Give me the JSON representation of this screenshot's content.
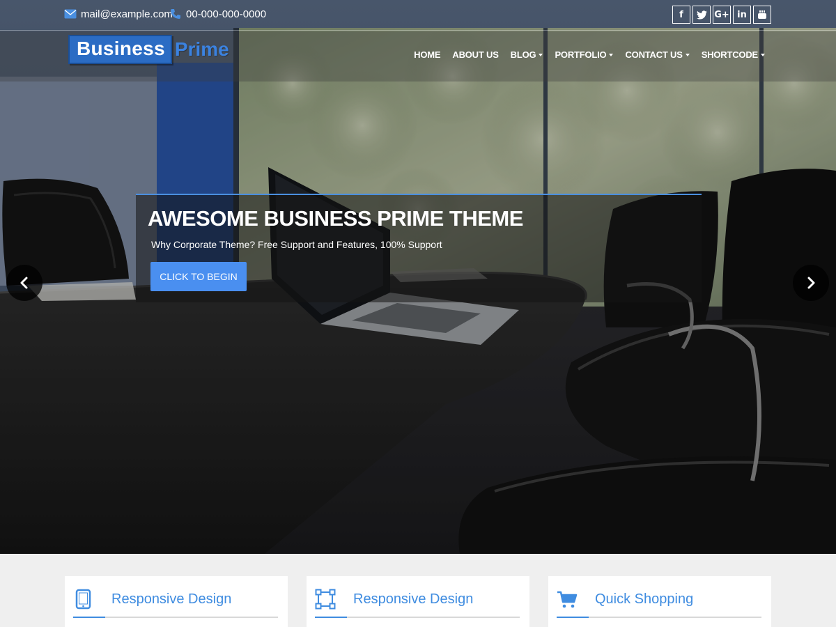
{
  "topbar": {
    "email": "mail@example.com",
    "phone": "00-000-000-0000",
    "socials": [
      {
        "icon": "facebook-icon",
        "glyph": "f"
      },
      {
        "icon": "twitter-icon",
        "glyph": "t"
      },
      {
        "icon": "google-plus-icon",
        "glyph": "G+"
      },
      {
        "icon": "linkedin-icon",
        "glyph": "in"
      },
      {
        "icon": "youtube-icon",
        "glyph": "▶"
      }
    ]
  },
  "header": {
    "logo": {
      "part1": "Business",
      "part2": "Prime"
    },
    "nav": [
      {
        "label": "HOME",
        "dropdown": false
      },
      {
        "label": "ABOUT US",
        "dropdown": false
      },
      {
        "label": "BLOG",
        "dropdown": true
      },
      {
        "label": "PORTFOLIO",
        "dropdown": true
      },
      {
        "label": "CONTACT US",
        "dropdown": true
      },
      {
        "label": "SHORTCODE",
        "dropdown": true
      }
    ]
  },
  "slider": {
    "title": "AWESOME BUSINESS PRIME THEME",
    "subtitle": "Why Corporate Theme? Free Support and Features, 100% Support",
    "button_label": "CLICK TO BEGIN"
  },
  "features": [
    {
      "icon": "tablet-icon",
      "title": "Responsive Design"
    },
    {
      "icon": "vector-square-icon",
      "title": "Responsive Design"
    },
    {
      "icon": "shopping-cart-icon",
      "title": "Quick Shopping"
    }
  ],
  "colors": {
    "accent": "#3f8ce0",
    "button": "#4a8ff0",
    "logo_blue": "#2b6cc4"
  }
}
